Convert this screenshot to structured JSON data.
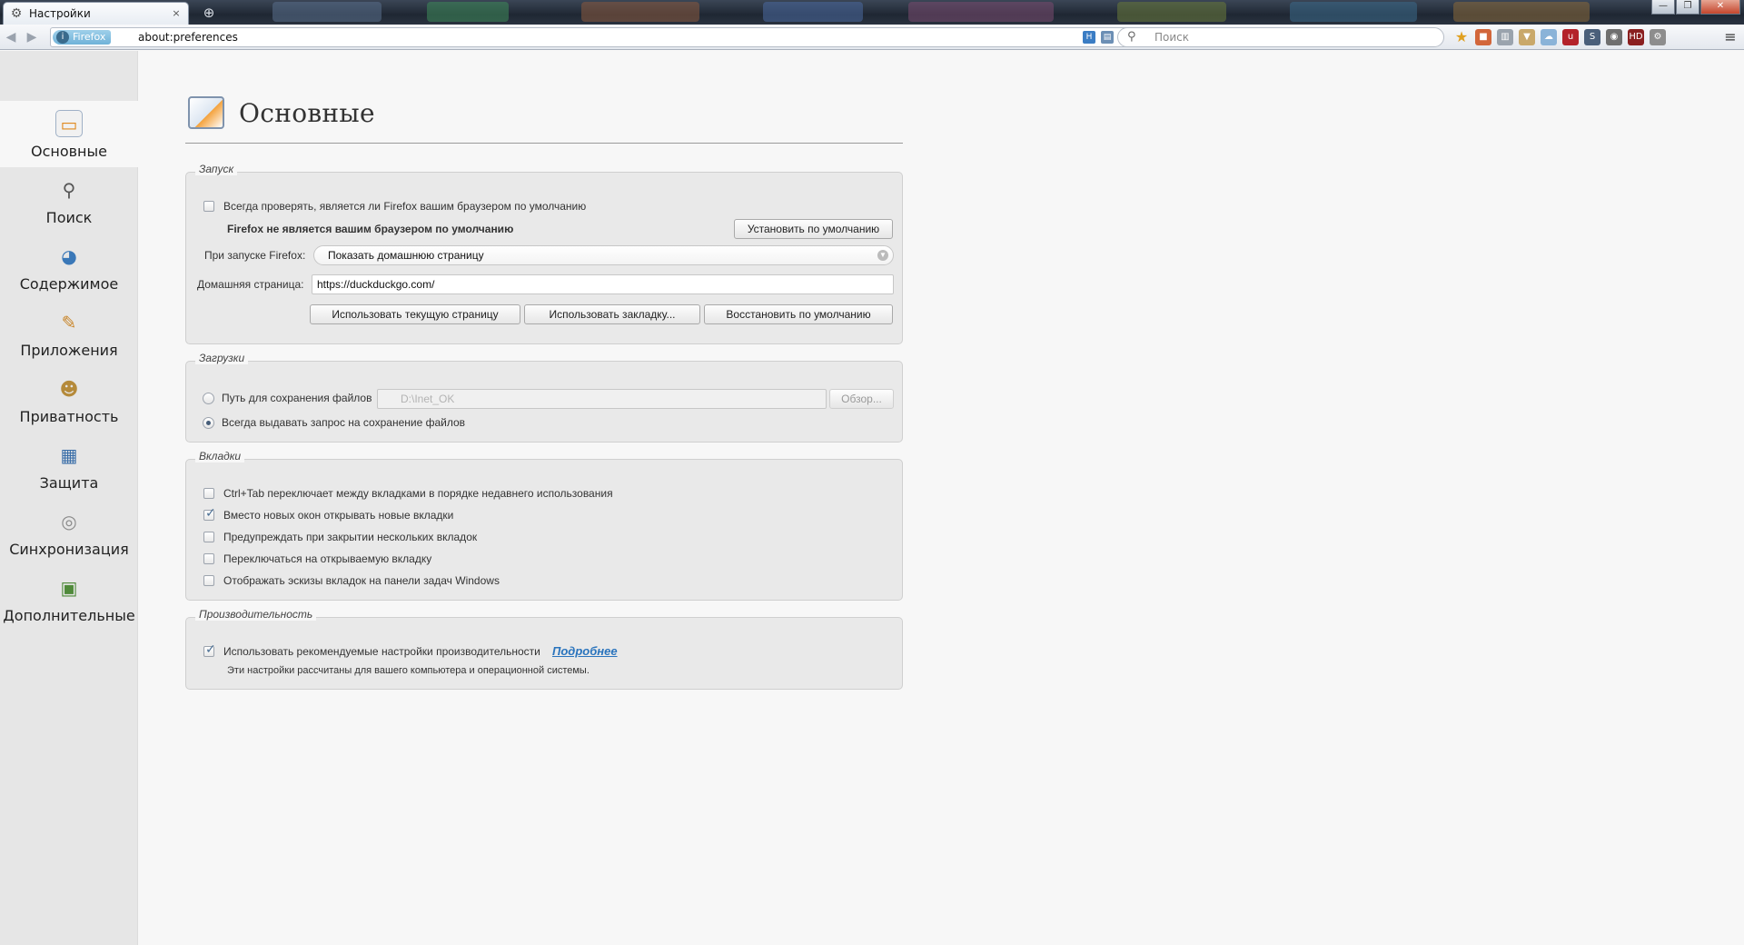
{
  "tab": {
    "title": "Настройки",
    "close": "×",
    "icon": "gear-icon"
  },
  "newtab": "⊕",
  "window_controls": {
    "minimize": "—",
    "maximize": "❐",
    "close": "✕"
  },
  "urlbar": {
    "identity": "Firefox",
    "url": "about:preferences"
  },
  "searchbar": {
    "placeholder": "Поиск"
  },
  "sidebar": {
    "items": [
      {
        "label": "Основные",
        "icon": "general-icon",
        "selected": true
      },
      {
        "label": "Поиск",
        "icon": "search-icon",
        "selected": false
      },
      {
        "label": "Содержимое",
        "icon": "content-icon",
        "selected": false
      },
      {
        "label": "Приложения",
        "icon": "applications-icon",
        "selected": false
      },
      {
        "label": "Приватность",
        "icon": "privacy-icon",
        "selected": false
      },
      {
        "label": "Защита",
        "icon": "security-icon",
        "selected": false
      },
      {
        "label": "Синхронизация",
        "icon": "sync-icon",
        "selected": false
      },
      {
        "label": "Дополнительные",
        "icon": "advanced-icon",
        "selected": false
      }
    ]
  },
  "page": {
    "title": "Основные"
  },
  "startup": {
    "caption": "Запуск",
    "check_default_label": "Всегда проверять, является ли Firefox вашим браузером по умолчанию",
    "check_default_checked": false,
    "not_default_text": "Firefox не является вашим браузером по умолчанию",
    "set_default_button": "Установить по умолчанию",
    "on_start_label": "При запуске Firefox:",
    "on_start_value": "Показать домашнюю страницу",
    "homepage_label": "Домашняя страница:",
    "homepage_value": "https://duckduckgo.com/",
    "use_current_button": "Использовать текущую страницу",
    "use_bookmark_button": "Использовать закладку...",
    "restore_default_button": "Восстановить по умолчанию"
  },
  "downloads": {
    "caption": "Загрузки",
    "save_to_label": "Путь для сохранения файлов",
    "save_to_selected": false,
    "save_path": "D:\\Inet_OK",
    "browse_button": "Обзор...",
    "always_ask_label": "Всегда выдавать запрос на сохранение файлов",
    "always_ask_selected": true
  },
  "tabs": {
    "caption": "Вкладки",
    "options": [
      {
        "label": "Ctrl+Tab переключает между вкладками в порядке недавнего использования",
        "checked": false
      },
      {
        "label": "Вместо новых окон открывать новые вкладки",
        "checked": true
      },
      {
        "label": "Предупреждать при закрытии нескольких вкладок",
        "checked": false
      },
      {
        "label": "Переключаться на открываемую вкладку",
        "checked": false
      },
      {
        "label": "Отображать эскизы вкладок на панели задач Windows",
        "checked": false
      }
    ]
  },
  "performance": {
    "caption": "Производительность",
    "recommended_label": "Использовать рекомендуемые настройки производительности",
    "recommended_checked": true,
    "learn_more": "Подробнее",
    "description": "Эти настройки рассчитаны для вашего компьютера и операционной системы."
  },
  "colors": {
    "accent": "#2a74bd",
    "sidebar_bg": "#e6e6e6",
    "page_bg": "#f7f7f7"
  }
}
